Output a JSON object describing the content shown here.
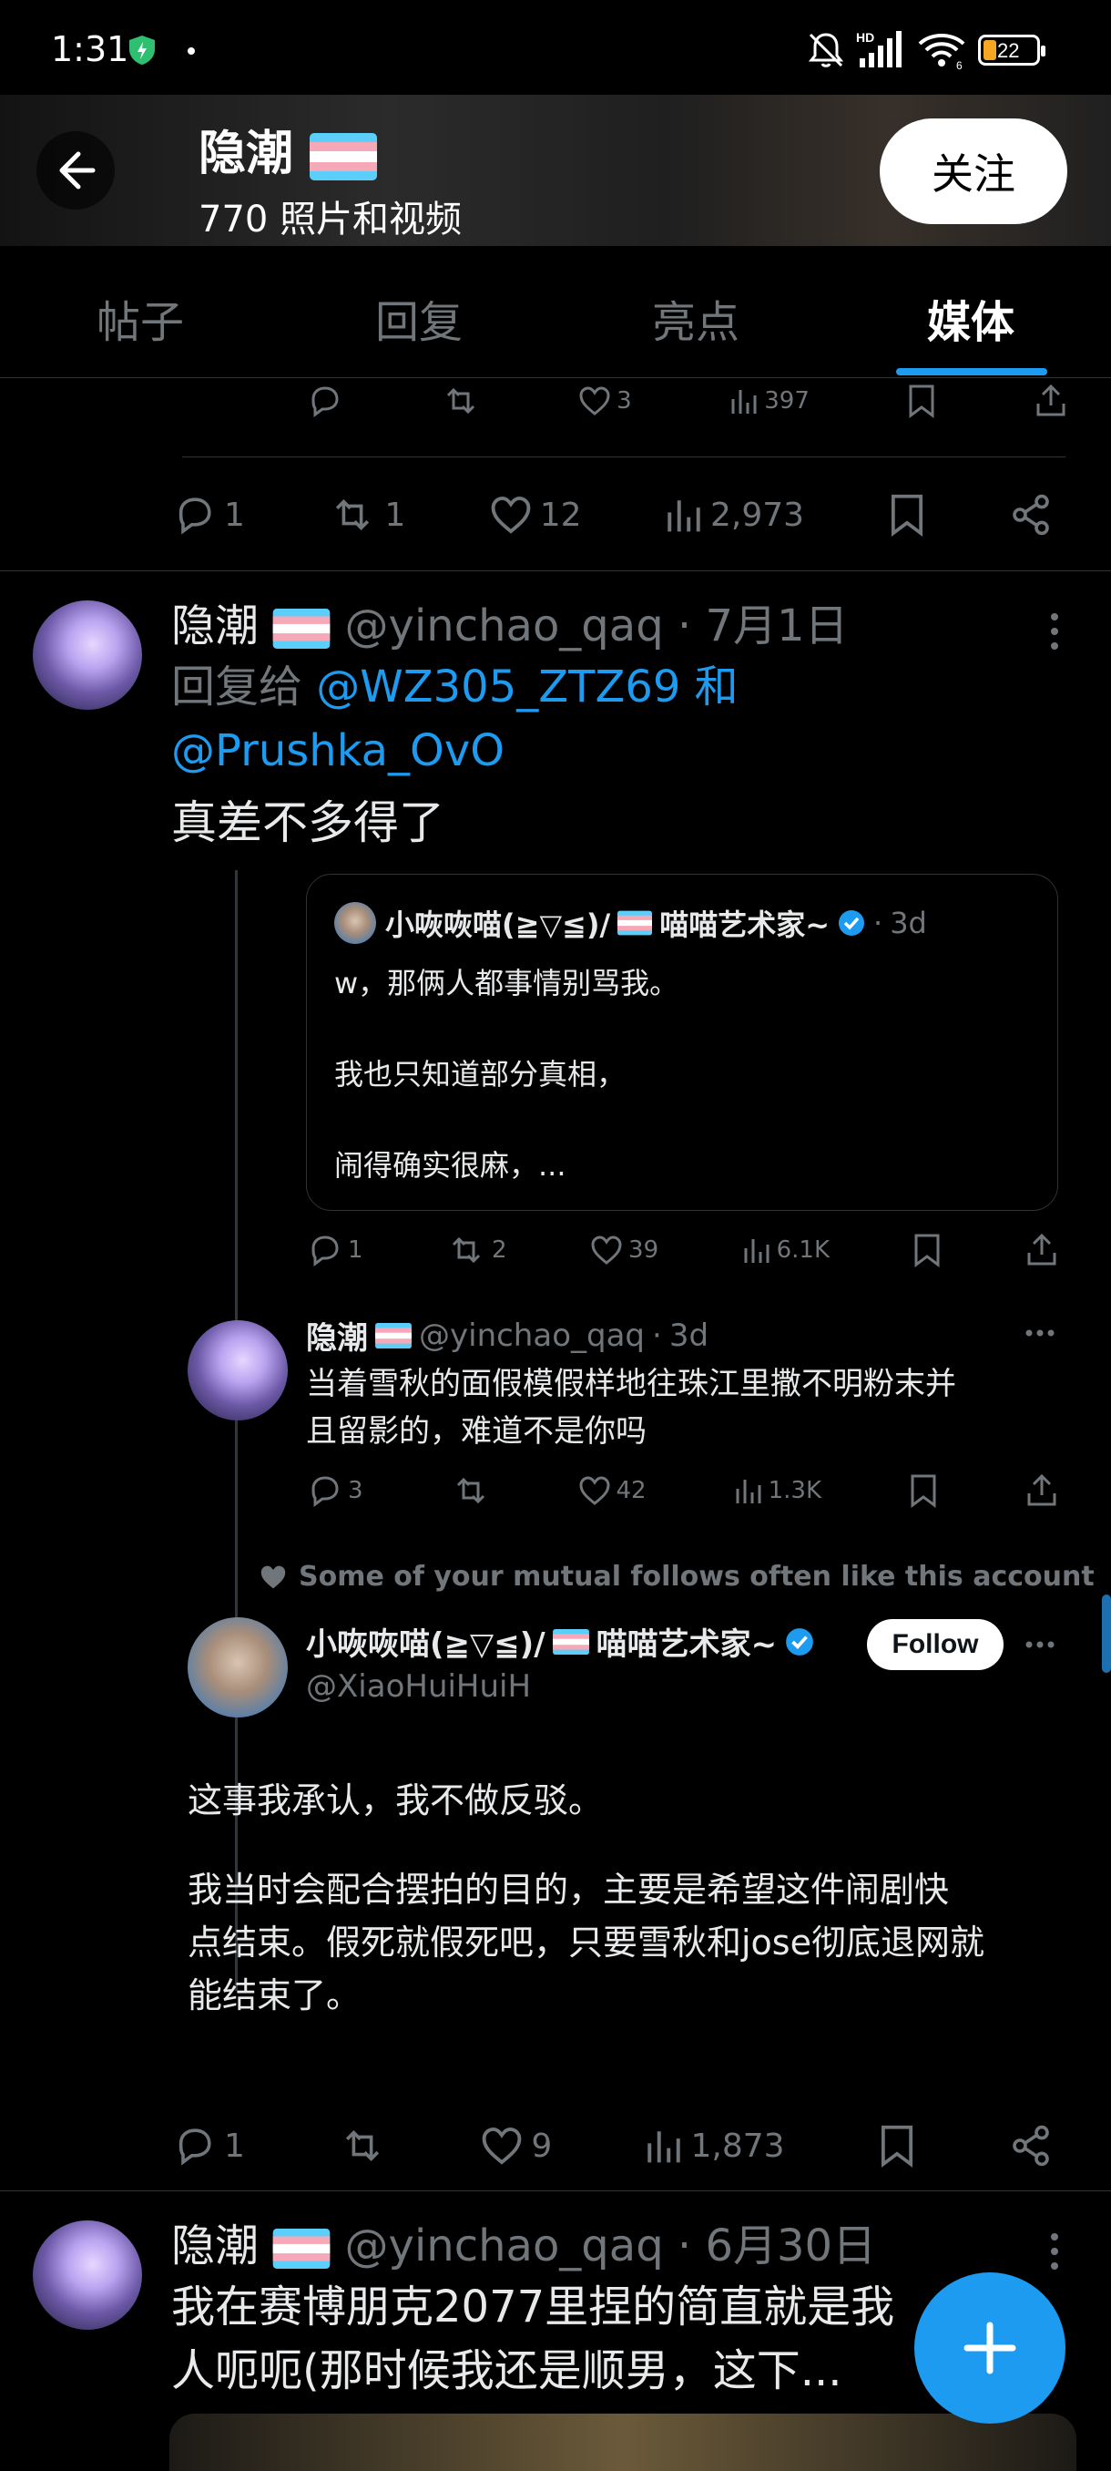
{
  "status_bar": {
    "time": "1:31",
    "battery": "22"
  },
  "header": {
    "name": "隐潮",
    "subtitle": "770 照片和视频",
    "follow_label": "关注"
  },
  "tabs": [
    {
      "label": "帖子"
    },
    {
      "label": "回复"
    },
    {
      "label": "亮点"
    },
    {
      "label": "媒体",
      "active": true
    }
  ],
  "post0": {
    "inner_actions": {
      "likes": "3",
      "views": "397"
    },
    "actions": {
      "replies": "1",
      "reposts": "1",
      "likes": "12",
      "views": "2,973"
    }
  },
  "post1": {
    "name": "隐潮",
    "handle": "@yinchao_qaq",
    "sep": "·",
    "date": "7月1日",
    "reply_prefix": "回复给",
    "reply_user1": "@WZ305_ZTZ69",
    "reply_and": "和",
    "reply_user2": "@Prushka_OvO",
    "text": "真差不多得了",
    "quoted": {
      "name": "小咴咴喵(≧▽≦)/",
      "name_suffix": "喵喵艺术家~",
      "time": "3d",
      "line1": "w，那俩人都事情别骂我。",
      "line2": "我也只知道部分真相，",
      "line3": "闹得确实很麻，...",
      "actions": {
        "replies": "1",
        "reposts": "2",
        "likes": "39",
        "views": "6.1K"
      }
    },
    "thread_reply": {
      "name": "隐潮",
      "handle": "@yinchao_qaq",
      "time": "3d",
      "text_line1": "当着雪秋的面假模假样地往珠江里撒不明粉末并",
      "text_line2": "且留影的，难道不是你吗",
      "actions": {
        "replies": "3",
        "likes": "42",
        "views": "1.3K"
      }
    },
    "social_context": "Some of your mutual follows often like this account",
    "embedded": {
      "name": "小咴咴喵(≧▽≦)/",
      "name_suffix": "喵喵艺术家~",
      "handle": "@XiaoHuiHuiH",
      "follow_label": "Follow",
      "para1": "这事我承认，我不做反驳。",
      "para2_line1": "我当时会配合摆拍的目的，主要是希望这件闹剧快",
      "para2_line2": "点结束。假死就假死吧，只要雪秋和jose彻底退网就",
      "para2_line3": "能结束了。"
    },
    "actions": {
      "replies": "1",
      "likes": "9",
      "views": "1,873"
    }
  },
  "post2": {
    "name": "隐潮",
    "handle": "@yinchao_qaq",
    "sep": "·",
    "date": "6月30日",
    "text_line1": "我在赛博朋克2077里捏的简直就是我",
    "text_line2": "人呃呃(那时候我还是顺男，这下..."
  },
  "colors": {
    "accent": "#1d9bf0",
    "background": "#000000",
    "muted": "#71767b",
    "text": "#e7e9ea"
  }
}
